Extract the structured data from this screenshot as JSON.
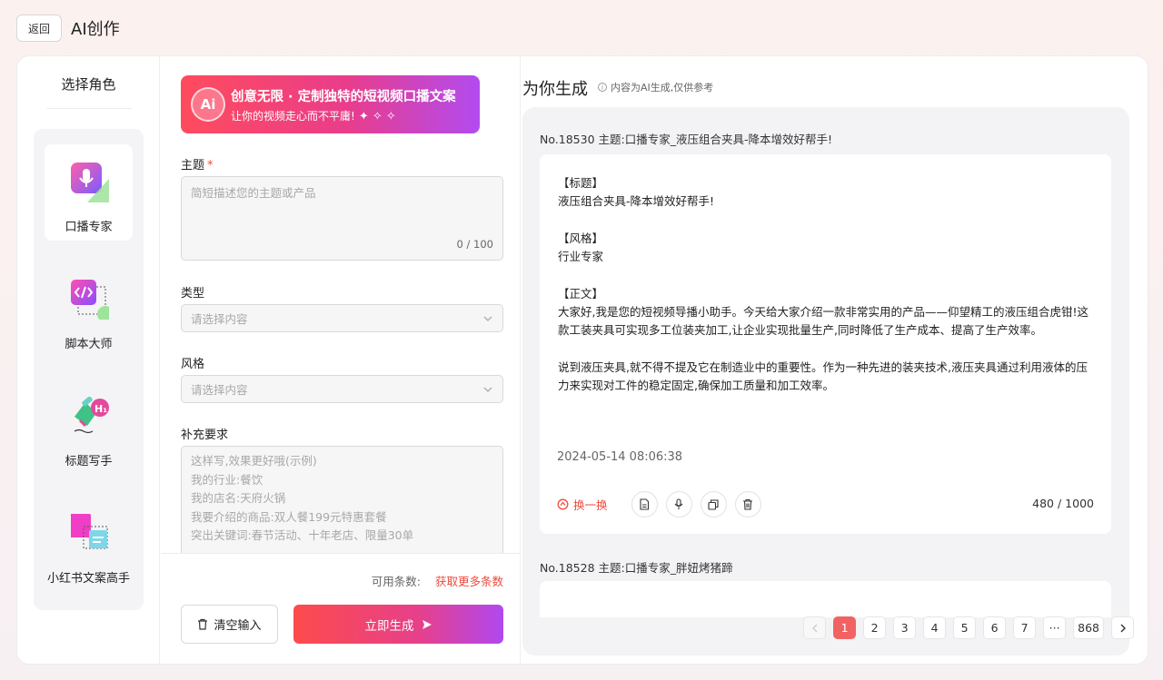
{
  "header": {
    "back_label": "返回",
    "title": "AI创作"
  },
  "roles": {
    "title": "选择角色",
    "items": [
      {
        "label": "口播专家",
        "icon": "microphone-icon",
        "active": true
      },
      {
        "label": "脚本大师",
        "icon": "code-script-icon",
        "active": false
      },
      {
        "label": "标题写手",
        "icon": "pen-heading-icon",
        "active": false
      },
      {
        "label": "小红书文案高手",
        "icon": "note-copy-icon",
        "active": false
      }
    ]
  },
  "banner": {
    "title": "创意无限 · 定制独特的短视频口播文案",
    "subtitle": "让你的视频走心而不平庸!",
    "sparkles": "✦ ✧ ✧",
    "badge": "Ai"
  },
  "form": {
    "topic_label": "主题",
    "required_mark": "*",
    "topic_placeholder": "简短描述您的主题或产品",
    "topic_counter": "0 / 100",
    "type_label": "类型",
    "type_placeholder": "请选择内容",
    "style_label": "风格",
    "style_placeholder": "请选择内容",
    "extra_label": "补充要求",
    "extra_placeholder_lines": [
      "这样写,效果更好哦(示例)",
      "我的行业:餐饮",
      "我的店名:天府火锅",
      "我要介绍的商品:双人餐199元特惠套餐",
      "突出关键词:春节活动、十年老店、限量30单"
    ],
    "quota_label": "可用条数:",
    "quota_link": "获取更多条数",
    "clear_label": "清空输入",
    "generate_label": "立即生成"
  },
  "result": {
    "title": "为你生成",
    "hint": "内容为AI生成,仅供参考",
    "records": [
      {
        "head": "No.18530 主题:口播专家_液压组合夹具-降本增效好帮手!",
        "paragraphs": [
          "【标题】",
          "液压组合夹具-降本增效好帮手!",
          "",
          "【风格】",
          "行业专家",
          "",
          "【正文】",
          "大家好,我是您的短视频导播小助手。今天给大家介绍一款非常实用的产品——仰望精工的液压组合虎钳!这款工装夹具可实现多工位装夹加工,让企业实现批量生产,同时降低了生产成本、提高了生产效率。",
          "",
          "说到液压夹具,就不得不提及它在制造业中的重要性。作为一种先进的装夹技术,液压夹具通过利用液体的压力来实现对工件的稳定固定,确保加工质量和加工效率。"
        ],
        "timestamp": "2024-05-14 08:06:38",
        "swap_label": "换一换",
        "word_count": "480 / 1000"
      },
      {
        "head": "No.18528 主题:口播专家_胖妞烤猪蹄"
      }
    ]
  },
  "pagination": {
    "pages": [
      "1",
      "2",
      "3",
      "4",
      "5",
      "6",
      "7",
      "···",
      "868"
    ],
    "current": "1"
  }
}
